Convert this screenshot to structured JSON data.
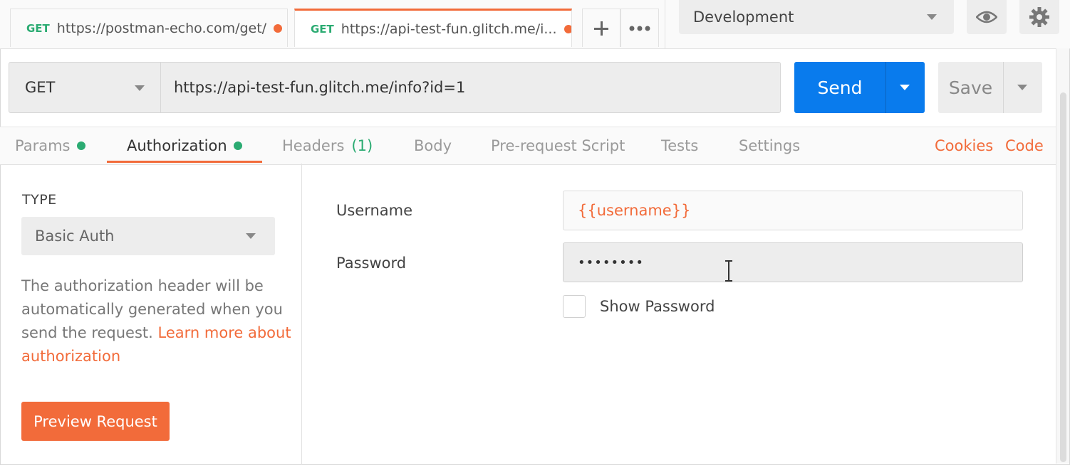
{
  "tabs": [
    {
      "method": "GET",
      "url": "https://postman-echo.com/get/"
    },
    {
      "method": "GET",
      "url": "https://api-test-fun.glitch.me/i..."
    }
  ],
  "tab_actions": {
    "add_icon": "plus-icon",
    "more_icon": "ellipsis-icon"
  },
  "environment": {
    "selected": "Development"
  },
  "header_icons": {
    "eye": "eye-icon",
    "settings": "gear-icon"
  },
  "request": {
    "method": "GET",
    "url": "https://api-test-fun.glitch.me/info?id=1",
    "send_label": "Send",
    "save_label": "Save"
  },
  "subtabs": {
    "params": "Params",
    "authorization": "Authorization",
    "headers": "Headers",
    "headers_count": "(1)",
    "body": "Body",
    "prerequest": "Pre-request Script",
    "tests": "Tests",
    "settings": "Settings",
    "cookies": "Cookies",
    "code": "Code"
  },
  "auth": {
    "type_label": "TYPE",
    "type_value": "Basic Auth",
    "help_text": "The authorization header will be automatically generated when you send the request.",
    "help_link": "Learn more about authorization",
    "preview_label": "Preview Request",
    "username_label": "Username",
    "username_value": "{{username}}",
    "password_label": "Password",
    "password_value": "••••••••",
    "show_password_label": "Show Password"
  },
  "colors": {
    "accent": "#f26b3a",
    "primary": "#097bed",
    "success": "#2bab72"
  }
}
